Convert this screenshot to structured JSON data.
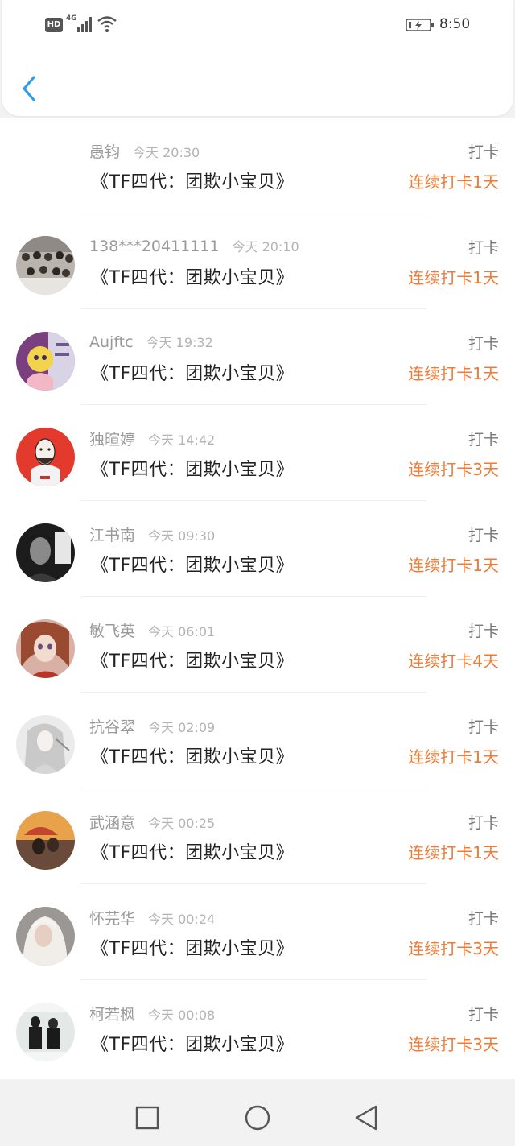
{
  "status_bar": {
    "hd_label": "HD",
    "network": "4G",
    "time": "8:50",
    "icons": [
      "hd-icon",
      "signal-icon",
      "wifi-icon",
      "battery-charging-icon"
    ]
  },
  "header": {
    "back_icon": "chevron-left-icon"
  },
  "colors": {
    "accent_blue": "#2f9ee8",
    "streak_orange": "#ef7b36",
    "text_gray": "#9a9a9a"
  },
  "records": [
    {
      "name": "愚钧",
      "time": "今天 20:30",
      "title": "《TF四代：团欺小宝贝》",
      "action": "打卡",
      "streak": "连续打卡1天"
    },
    {
      "name": "138***20411111",
      "time": "今天 20:10",
      "title": "《TF四代：团欺小宝贝》",
      "action": "打卡",
      "streak": "连续打卡1天"
    },
    {
      "name": "Aujftc",
      "time": "今天 19:32",
      "title": "《TF四代：团欺小宝贝》",
      "action": "打卡",
      "streak": "连续打卡1天"
    },
    {
      "name": "独暄婷",
      "time": "今天 14:42",
      "title": "《TF四代：团欺小宝贝》",
      "action": "打卡",
      "streak": "连续打卡3天"
    },
    {
      "name": "江书南",
      "time": "今天 09:30",
      "title": "《TF四代：团欺小宝贝》",
      "action": "打卡",
      "streak": "连续打卡1天"
    },
    {
      "name": "敏飞英",
      "time": "今天 06:01",
      "title": "《TF四代：团欺小宝贝》",
      "action": "打卡",
      "streak": "连续打卡4天"
    },
    {
      "name": "抗谷翠",
      "time": "今天 02:09",
      "title": "《TF四代：团欺小宝贝》",
      "action": "打卡",
      "streak": "连续打卡1天"
    },
    {
      "name": "武涵意",
      "time": "今天 00:25",
      "title": "《TF四代：团欺小宝贝》",
      "action": "打卡",
      "streak": "连续打卡1天"
    },
    {
      "name": "怀芫华",
      "time": "今天 00:24",
      "title": "《TF四代：团欺小宝贝》",
      "action": "打卡",
      "streak": "连续打卡3天"
    },
    {
      "name": "柯若枫",
      "time": "今天 00:08",
      "title": "《TF四代：团欺小宝贝》",
      "action": "打卡",
      "streak": "连续打卡3天"
    }
  ],
  "nav_bar": {
    "icons": [
      "square-recents-icon",
      "circle-home-icon",
      "triangle-back-icon"
    ]
  }
}
